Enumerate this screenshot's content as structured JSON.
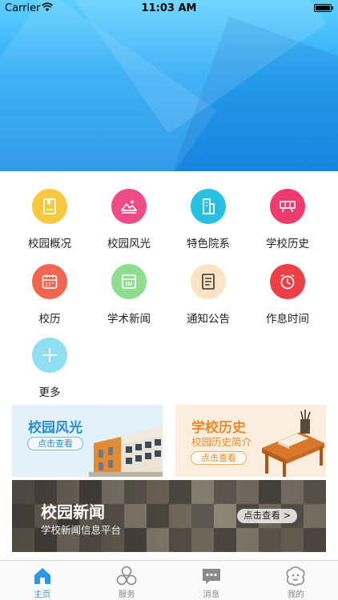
{
  "status_bar": {
    "carrier": "Carrier",
    "time": "11:03 AM"
  },
  "menu": {
    "items": [
      {
        "label": "校园概况",
        "icon": "book-icon",
        "color": "#f8c940"
      },
      {
        "label": "校园风光",
        "icon": "landscape-icon",
        "color": "#ef4b84"
      },
      {
        "label": "特色院系",
        "icon": "building-icon",
        "color": "#27c0e2"
      },
      {
        "label": "学校历史",
        "icon": "cart-icon",
        "color": "#f03b6e"
      },
      {
        "label": "校历",
        "icon": "calendar-icon",
        "color": "#f2654e"
      },
      {
        "label": "学术新闻",
        "icon": "news-icon",
        "color": "#8fdd8f"
      },
      {
        "label": "通知公告",
        "icon": "notice-icon",
        "color": "#fbe3c4"
      },
      {
        "label": "作息时间",
        "icon": "alarm-clock-icon",
        "color": "#ec3f46"
      },
      {
        "label": "更多",
        "icon": "plus-icon",
        "color": "#8fdff0"
      }
    ]
  },
  "banners": {
    "fengguang": {
      "title": "校园风光",
      "button": "点击查看"
    },
    "history": {
      "title": "学校历史",
      "subtitle": "校园历史简介",
      "button": "点击查看"
    },
    "news": {
      "title": "校园新闻",
      "subtitle": "学校新闻信息平台",
      "button": "点击查看 >"
    }
  },
  "tabbar": {
    "items": [
      {
        "label": "主页",
        "icon": "home-icon",
        "active": true
      },
      {
        "label": "服务",
        "icon": "services-icon",
        "active": false
      },
      {
        "label": "消息",
        "icon": "message-icon",
        "active": false
      },
      {
        "label": "我的",
        "icon": "profile-icon",
        "active": false
      }
    ]
  },
  "colors": {
    "accent": "#2b95f0",
    "fengguang": "#2a8fd4",
    "history": "#ec8a2b"
  }
}
